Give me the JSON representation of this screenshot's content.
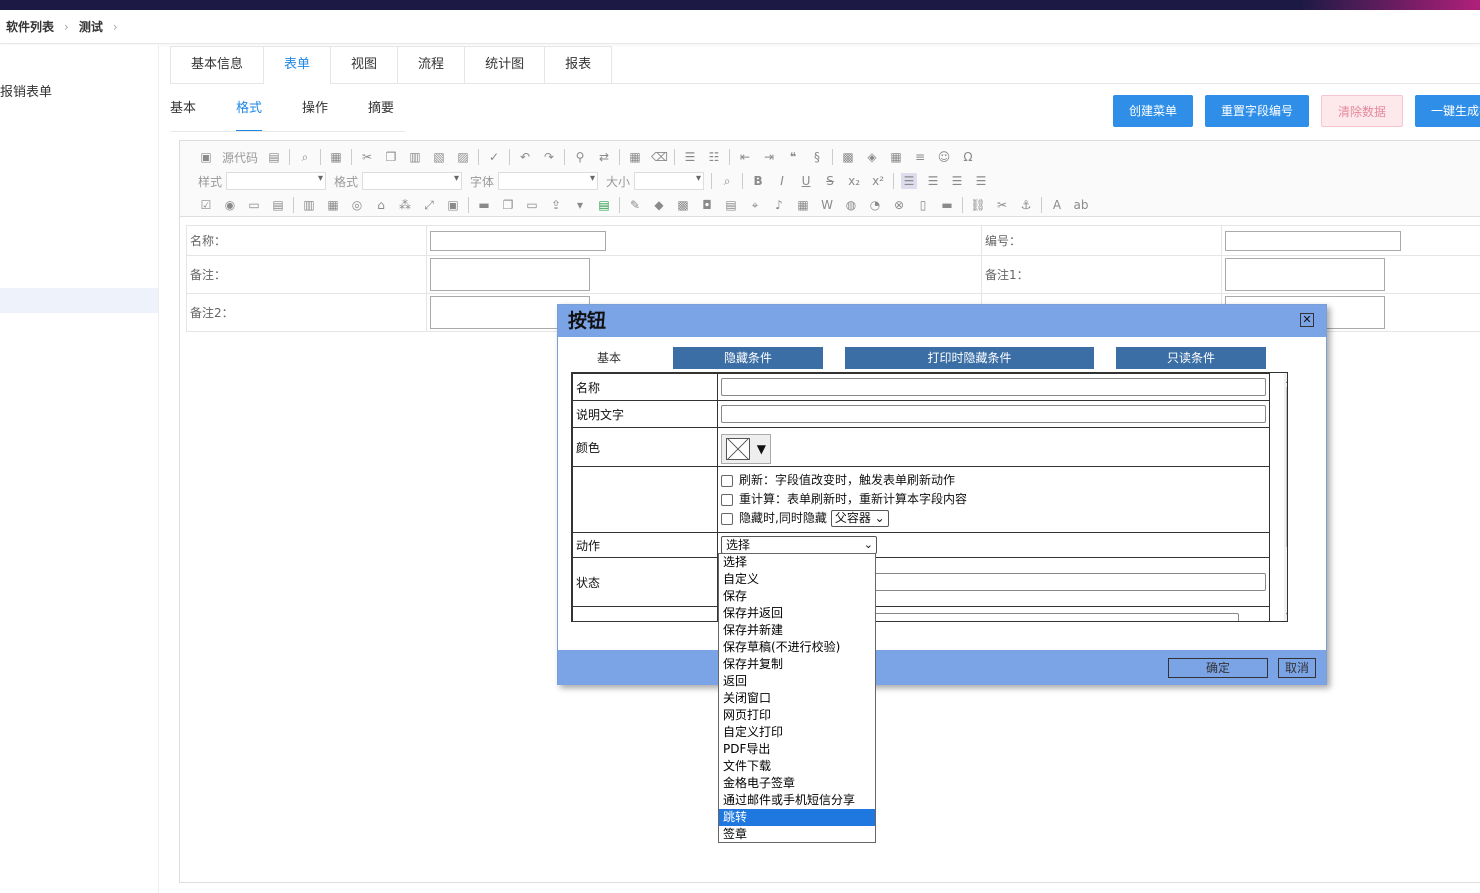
{
  "breadcrumb": {
    "items": [
      "软件列表",
      "测试"
    ]
  },
  "sidebar": {
    "items": [
      "报销表单"
    ]
  },
  "main_tabs": [
    "基本信息",
    "表单",
    "视图",
    "流程",
    "统计图",
    "报表"
  ],
  "sub_tabs": [
    "基本",
    "格式",
    "操作",
    "摘要"
  ],
  "action_buttons": {
    "create_menu": "创建菜单",
    "reset_field_ids": "重置字段编号",
    "clear_data": "清除数据",
    "generate": "一键生成视"
  },
  "toolbar": {
    "source": "源代码",
    "style_label": "样式",
    "format_label": "格式",
    "font_label": "字体",
    "size_label": "大小"
  },
  "form": {
    "name_label": "名称：",
    "code_label": "编号：",
    "note_label": "备注：",
    "note1_label": "备注1：",
    "note2_label": "备注2："
  },
  "dialog": {
    "title": "按钮",
    "tabs": [
      "基本",
      "隐藏条件",
      "打印时隐藏条件",
      "只读条件"
    ],
    "rows": {
      "name": "名称",
      "desc": "说明文字",
      "color": "颜色",
      "action": "动作",
      "status": "状态"
    },
    "options": {
      "refresh": "刷新：字段值改变时，触发表单刷新动作",
      "recalc": "重计算：表单刷新时，重新计算本字段内容",
      "hide_parent": "隐藏时,同时隐藏",
      "parent_select": "父容器"
    },
    "action_value": "选择",
    "ok": "确定",
    "cancel": "取消"
  },
  "dropdown": {
    "items": [
      "选择",
      "自定义",
      "保存",
      "保存并返回",
      "保存并新建",
      "保存草稿(不进行校验)",
      "保存并复制",
      "返回",
      "关闭窗口",
      "网页打印",
      "自定义打印",
      "PDF导出",
      "文件下载",
      "金格电子签章",
      "通过邮件或手机短信分享",
      "跳转",
      "签章"
    ],
    "selected": "跳转"
  },
  "colors": {
    "accent": "#2f8fe8",
    "dialog_header": "#7ba4e6",
    "dialog_tab": "#3a6ea5",
    "selection": "#1e78e0"
  }
}
